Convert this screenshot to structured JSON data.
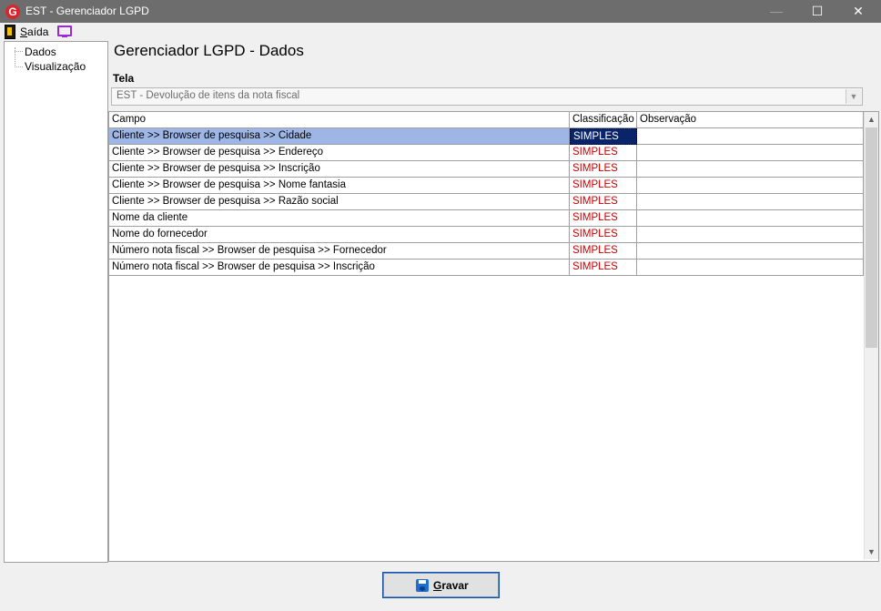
{
  "window": {
    "title": "EST - Gerenciador LGPD",
    "icon": "app-logo-icon",
    "controls": {
      "minimize": "—",
      "maximize": "☐",
      "close": "✕"
    }
  },
  "menu": {
    "saida_first": "S",
    "saida_rest": "aída"
  },
  "tree": {
    "items": [
      {
        "label": "Dados"
      },
      {
        "label": "Visualização"
      }
    ]
  },
  "main": {
    "title": "Gerenciador LGPD - Dados",
    "tela_label": "Tela",
    "tela_value": "EST - Devolução de itens da nota fiscal"
  },
  "grid": {
    "columns": [
      "Campo",
      "Classificação",
      "Observação"
    ],
    "rows": [
      {
        "campo": "Cliente >> Browser de pesquisa >> Cidade",
        "classificacao": "SIMPLES",
        "observacao": ""
      },
      {
        "campo": "Cliente >> Browser de pesquisa >> Endereço",
        "classificacao": "SIMPLES",
        "observacao": ""
      },
      {
        "campo": "Cliente >> Browser de pesquisa >> Inscrição",
        "classificacao": "SIMPLES",
        "observacao": ""
      },
      {
        "campo": "Cliente >> Browser de pesquisa >> Nome fantasia",
        "classificacao": "SIMPLES",
        "observacao": ""
      },
      {
        "campo": "Cliente >> Browser de pesquisa >> Razão social",
        "classificacao": "SIMPLES",
        "observacao": ""
      },
      {
        "campo": "Nome da cliente",
        "classificacao": "SIMPLES",
        "observacao": ""
      },
      {
        "campo": "Nome do fornecedor",
        "classificacao": "SIMPLES",
        "observacao": ""
      },
      {
        "campo": "Número nota fiscal >> Browser de pesquisa >> Fornecedor",
        "classificacao": "SIMPLES",
        "observacao": ""
      },
      {
        "campo": "Número nota fiscal >> Browser de pesquisa >> Inscrição",
        "classificacao": "SIMPLES",
        "observacao": ""
      }
    ],
    "selected_row": 0
  },
  "footer": {
    "gravar_first": "G",
    "gravar_rest": "ravar"
  },
  "colors": {
    "titlebar": "#6d6d6d",
    "selection": "#9eb6e6",
    "classificacao_text": "#cc0000",
    "accent_border": "#1a4f9c"
  }
}
